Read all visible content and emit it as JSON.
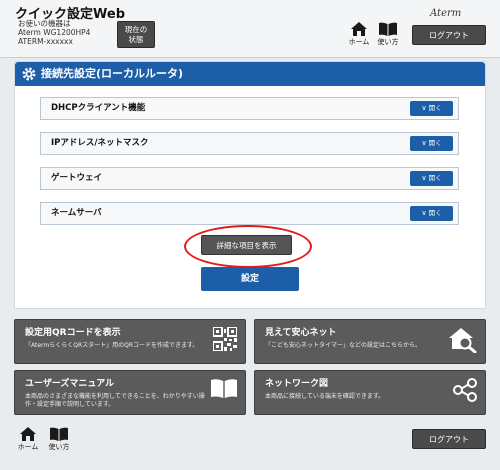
{
  "header": {
    "app_title": "クイック設定Web",
    "device_label": "お使いの機器は",
    "device_model": "Aterm WG1200HP4",
    "device_id": "ATERM-xxxxxx",
    "status_button_line1": "現在の",
    "status_button_line2": "状態",
    "brand": "Aterm",
    "home_label": "ホーム",
    "manual_label": "使い方",
    "logout_label": "ログアウト"
  },
  "panel": {
    "title": "接続先設定(ローカルルータ)",
    "rows": [
      {
        "label": "DHCPクライアント機能",
        "button": "開く"
      },
      {
        "label": "IPアドレス/ネットマスク",
        "button": "開く"
      },
      {
        "label": "ゲートウェイ",
        "button": "開く"
      },
      {
        "label": "ネームサーバ",
        "button": "開く"
      }
    ],
    "detail_button": "詳細な項目を表示",
    "save_button": "設定"
  },
  "tiles": [
    {
      "title": "設定用QRコードを表示",
      "desc": "「AtermらくらくQRスタート」用のQRコードを作成できます。",
      "icon": "qr-code-icon"
    },
    {
      "title": "見えて安心ネット",
      "desc": "「こども安心ネットタイマー」などの設定はこちらから。",
      "icon": "home-search-icon"
    },
    {
      "title": "ユーザーズマニュアル",
      "desc": "本商品のさまざまな機能を利用してできることを、わかりやすい操作・設定手順で説明しています。",
      "icon": "book-icon"
    },
    {
      "title": "ネットワーク図",
      "desc": "本商品に接続している端末を確認できます。",
      "icon": "network-icon"
    }
  ],
  "footer": {
    "home_label": "ホーム",
    "manual_label": "使い方",
    "logout_label": "ログアウト"
  },
  "colors": {
    "accent": "#1c5ea8",
    "tile": "#5b5b5b",
    "highlight": "#e21b1b"
  }
}
